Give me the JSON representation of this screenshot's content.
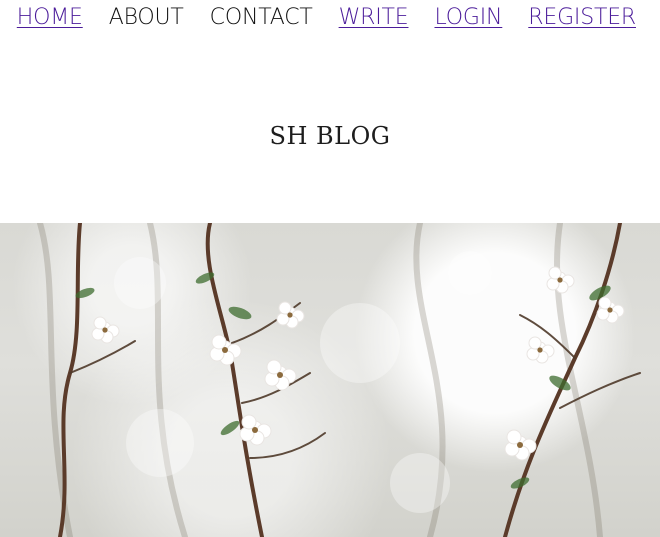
{
  "nav": {
    "home": "HOME",
    "about": "ABOUT",
    "contact": "CONTACT",
    "write": "WRITE",
    "login": "LOGIN",
    "register": "REGISTER"
  },
  "header": {
    "title": "SH BLOG"
  },
  "colors": {
    "link_visited": "#4b1c9a",
    "text_dark": "#111111",
    "hero_bg": "#dfdfdb"
  }
}
